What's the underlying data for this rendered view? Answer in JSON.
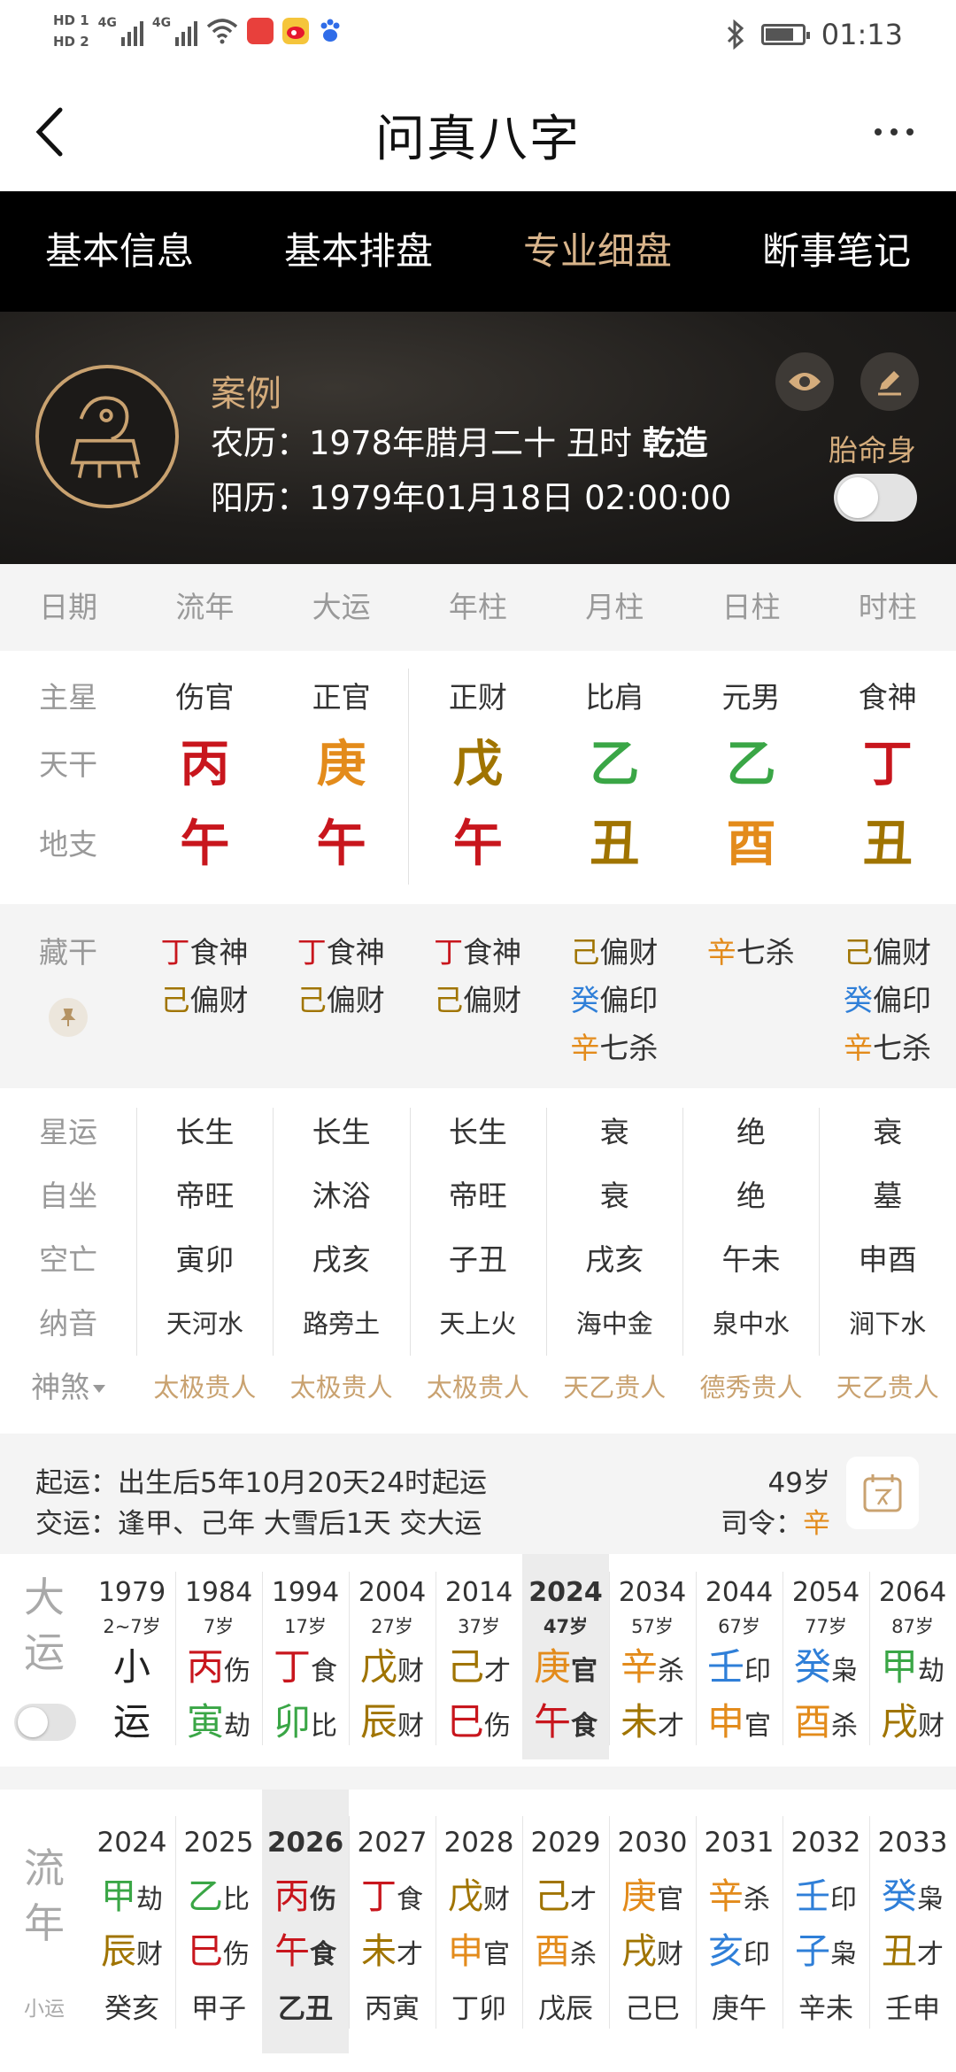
{
  "colors": {
    "red": "#c8161d",
    "gold": "#a07400",
    "green": "#3aa646",
    "orange": "#e38b1b",
    "blue": "#2f7fd8",
    "black": "#222222",
    "accent": "#d8b48b"
  },
  "status_bar": {
    "hd1": "HD 1",
    "hd2": "HD 2",
    "sig1": "4G",
    "sig2": "4G",
    "time": "01:13",
    "icons": [
      "wifi-icon",
      "huawei-app-icon",
      "weibo-icon",
      "baidu-icon",
      "bluetooth-icon",
      "battery-icon"
    ]
  },
  "header": {
    "title": "问真八字"
  },
  "tabs": [
    {
      "label": "基本信息",
      "active": false
    },
    {
      "label": "基本排盘",
      "active": false
    },
    {
      "label": "专业细盘",
      "active": true
    },
    {
      "label": "断事笔记",
      "active": false
    }
  ],
  "profile": {
    "name": "案例",
    "lunar_prefix": "农历：1978年腊月二十 丑时 ",
    "lunar_bold": "乾造",
    "solar": "阳历：1979年01月18日 02:00:00",
    "taimingshen": "胎命身"
  },
  "columns": [
    "日期",
    "流年",
    "大运",
    "年柱",
    "月柱",
    "日柱",
    "时柱"
  ],
  "pillars": {
    "labels": {
      "main": "主星",
      "gan": "天干",
      "zhi": "地支"
    },
    "main_stars": [
      "伤官",
      "正官",
      "正财",
      "比肩",
      "元男",
      "食神"
    ],
    "gan": [
      {
        "t": "丙",
        "c": "red"
      },
      {
        "t": "庚",
        "c": "orange"
      },
      {
        "t": "戊",
        "c": "gold"
      },
      {
        "t": "乙",
        "c": "green"
      },
      {
        "t": "乙",
        "c": "green"
      },
      {
        "t": "丁",
        "c": "red"
      }
    ],
    "zhi": [
      {
        "t": "午",
        "c": "red"
      },
      {
        "t": "午",
        "c": "red"
      },
      {
        "t": "午",
        "c": "red"
      },
      {
        "t": "丑",
        "c": "gold"
      },
      {
        "t": "酉",
        "c": "orange"
      },
      {
        "t": "丑",
        "c": "gold"
      }
    ]
  },
  "hidden_stems": {
    "label": "藏干",
    "cols": [
      [
        {
          "s": "丁",
          "c": "red",
          "g": "食神"
        },
        {
          "s": "己",
          "c": "gold",
          "g": "偏财"
        }
      ],
      [
        {
          "s": "丁",
          "c": "red",
          "g": "食神"
        },
        {
          "s": "己",
          "c": "gold",
          "g": "偏财"
        }
      ],
      [
        {
          "s": "丁",
          "c": "red",
          "g": "食神"
        },
        {
          "s": "己",
          "c": "gold",
          "g": "偏财"
        }
      ],
      [
        {
          "s": "己",
          "c": "gold",
          "g": "偏财"
        },
        {
          "s": "癸",
          "c": "blue",
          "g": "偏印"
        },
        {
          "s": "辛",
          "c": "orange",
          "g": "七杀"
        }
      ],
      [
        {
          "s": "辛",
          "c": "orange",
          "g": "七杀"
        }
      ],
      [
        {
          "s": "己",
          "c": "gold",
          "g": "偏财"
        },
        {
          "s": "癸",
          "c": "blue",
          "g": "偏印"
        },
        {
          "s": "辛",
          "c": "orange",
          "g": "七杀"
        }
      ]
    ]
  },
  "detail": {
    "rows": [
      {
        "label": "星运",
        "values": [
          "长生",
          "长生",
          "长生",
          "衰",
          "绝",
          "衰"
        ]
      },
      {
        "label": "自坐",
        "values": [
          "帝旺",
          "沐浴",
          "帝旺",
          "衰",
          "绝",
          "墓"
        ]
      },
      {
        "label": "空亡",
        "values": [
          "寅卯",
          "戌亥",
          "子丑",
          "戌亥",
          "午未",
          "申酉"
        ]
      },
      {
        "label": "纳音",
        "values": [
          "天河水",
          "路旁土",
          "天上火",
          "海中金",
          "泉中水",
          "涧下水"
        ]
      }
    ],
    "shensha_label": "神煞",
    "shensha": [
      "太极贵人",
      "太极贵人",
      "太极贵人",
      "天乙贵人",
      "德秀贵人",
      "天乙贵人"
    ]
  },
  "start_luck": {
    "line1": "起运：出生后5年10月20天24时起运",
    "line2": "交运：逢甲、己年 大雪后1天 交大运",
    "age": "49岁",
    "siling_prefix": "司令：",
    "siling_value": "辛"
  },
  "dayun": {
    "title1": "大",
    "title2": "运",
    "cols": [
      {
        "year": "1979",
        "age": "2~7岁",
        "xiao": true,
        "s1": "小",
        "s2": "运"
      },
      {
        "year": "1984",
        "age": "7岁",
        "g": "丙",
        "gc": "red",
        "gg": "伤",
        "z": "寅",
        "zc": "green",
        "zg": "劫"
      },
      {
        "year": "1994",
        "age": "17岁",
        "g": "丁",
        "gc": "red",
        "gg": "食",
        "z": "卯",
        "zc": "green",
        "zg": "比"
      },
      {
        "year": "2004",
        "age": "27岁",
        "g": "戊",
        "gc": "gold",
        "gg": "财",
        "z": "辰",
        "zc": "gold",
        "zg": "财"
      },
      {
        "year": "2014",
        "age": "37岁",
        "g": "己",
        "gc": "gold",
        "gg": "才",
        "z": "巳",
        "zc": "red",
        "zg": "伤"
      },
      {
        "year": "2024",
        "age": "47岁",
        "hl": true,
        "g": "庚",
        "gc": "orange",
        "gg": "官",
        "z": "午",
        "zc": "red",
        "zg": "食"
      },
      {
        "year": "2034",
        "age": "57岁",
        "g": "辛",
        "gc": "orange",
        "gg": "杀",
        "z": "未",
        "zc": "gold",
        "zg": "才"
      },
      {
        "year": "2044",
        "age": "67岁",
        "g": "壬",
        "gc": "blue",
        "gg": "印",
        "z": "申",
        "zc": "orange",
        "zg": "官"
      },
      {
        "year": "2054",
        "age": "77岁",
        "g": "癸",
        "gc": "blue",
        "gg": "枭",
        "z": "酉",
        "zc": "orange",
        "zg": "杀"
      },
      {
        "year": "2064",
        "age": "87岁",
        "g": "甲",
        "gc": "green",
        "gg": "劫",
        "z": "戌",
        "zc": "gold",
        "zg": "财"
      }
    ]
  },
  "liunian": {
    "title1": "流",
    "title2": "年",
    "xiaoyun": "小运",
    "cols": [
      {
        "year": "2024",
        "g": "甲",
        "gc": "green",
        "gg": "劫",
        "z": "辰",
        "zc": "gold",
        "zg": "财",
        "xy": "癸亥"
      },
      {
        "year": "2025",
        "g": "乙",
        "gc": "green",
        "gg": "比",
        "z": "巳",
        "zc": "red",
        "zg": "伤",
        "xy": "甲子"
      },
      {
        "year": "2026",
        "hl": true,
        "g": "丙",
        "gc": "red",
        "gg": "伤",
        "z": "午",
        "zc": "red",
        "zg": "食",
        "xy": "乙丑"
      },
      {
        "year": "2027",
        "g": "丁",
        "gc": "red",
        "gg": "食",
        "z": "未",
        "zc": "gold",
        "zg": "才",
        "xy": "丙寅"
      },
      {
        "year": "2028",
        "g": "戊",
        "gc": "gold",
        "gg": "财",
        "z": "申",
        "zc": "orange",
        "zg": "官",
        "xy": "丁卯"
      },
      {
        "year": "2029",
        "g": "己",
        "gc": "gold",
        "gg": "才",
        "z": "酉",
        "zc": "orange",
        "zg": "杀",
        "xy": "戊辰"
      },
      {
        "year": "2030",
        "g": "庚",
        "gc": "orange",
        "gg": "官",
        "z": "戌",
        "zc": "gold",
        "zg": "财",
        "xy": "己巳"
      },
      {
        "year": "2031",
        "g": "辛",
        "gc": "orange",
        "gg": "杀",
        "z": "亥",
        "zc": "blue",
        "zg": "印",
        "xy": "庚午"
      },
      {
        "year": "2032",
        "g": "壬",
        "gc": "blue",
        "gg": "印",
        "z": "子",
        "zc": "blue",
        "zg": "枭",
        "xy": "辛未"
      },
      {
        "year": "2033",
        "g": "癸",
        "gc": "blue",
        "gg": "枭",
        "z": "丑",
        "zc": "gold",
        "zg": "才",
        "xy": "壬申"
      }
    ]
  }
}
